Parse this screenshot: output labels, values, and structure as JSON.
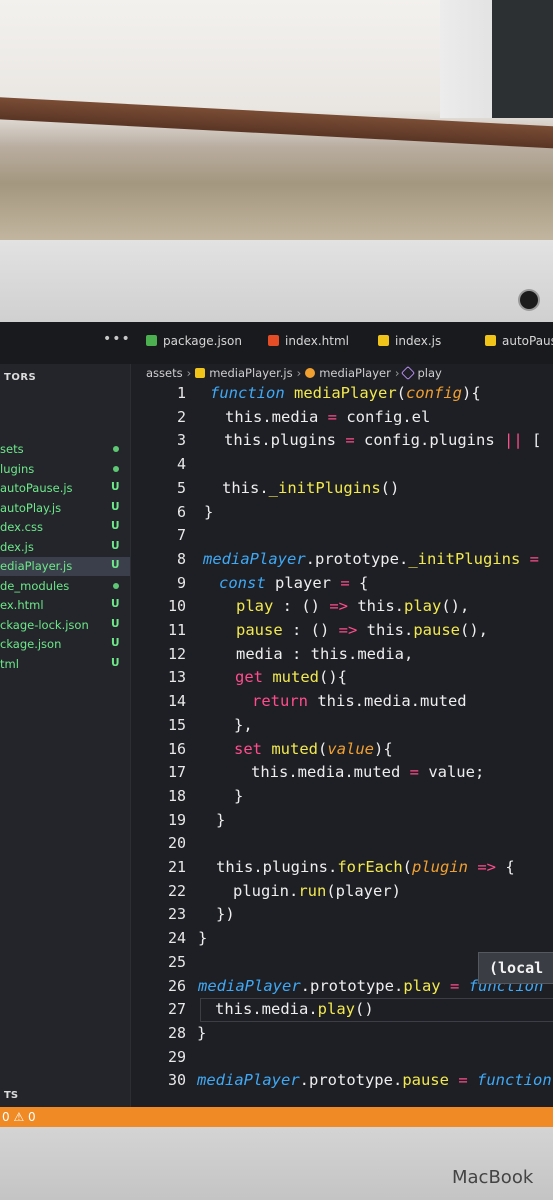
{
  "tabs": [
    {
      "label": "package.json",
      "color": "#4caf50"
    },
    {
      "label": "index.html",
      "color": "#e44d26"
    },
    {
      "label": "index.js",
      "color": "#f0c419"
    },
    {
      "label": "autoPaus",
      "color": "#f0c419"
    }
  ],
  "tab_overflow": "•••",
  "sidebar": {
    "title": "TORS",
    "items": [
      {
        "label": "sets",
        "status": "dot"
      },
      {
        "label": "lugins",
        "status": "dot"
      },
      {
        "label": "autoPause.js",
        "status": "U"
      },
      {
        "label": "autoPlay.js",
        "status": "U"
      },
      {
        "label": "dex.css",
        "status": "U"
      },
      {
        "label": "dex.js",
        "status": "U"
      },
      {
        "label": "ediaPlayer.js",
        "status": "U",
        "active": true
      },
      {
        "label": "de_modules",
        "status": "dot"
      },
      {
        "label": "ex.html",
        "status": "U"
      },
      {
        "label": "ckage-lock.json",
        "status": "U"
      },
      {
        "label": "ckage.json",
        "status": "U"
      },
      {
        "label": "tml",
        "status": "U"
      }
    ],
    "bottom_label": "TS"
  },
  "breadcrumb": [
    "assets",
    "mediaPlayer.js",
    "mediaPlayer",
    "play"
  ],
  "hover_label": "(local",
  "status_text": "0 ⚠ 0",
  "brand": "MacBook",
  "code_lines": [
    {
      "n": "1",
      "indent": 0,
      "html": "<span style='color:#3fa9f5;font-style:italic'>function</span> <span style='color:#f2e94e'>mediaPlayer</span>(<span style='color:#f0a030;font-style:italic'>config</span>){"
    },
    {
      "n": "2",
      "indent": 1,
      "html": "this.media <span style='color:#ff4d8d'>=</span> config.el"
    },
    {
      "n": "3",
      "indent": 1,
      "html": "this.plugins <span style='color:#ff4d8d'>=</span> config.plugins <span style='color:#ff4d8d'>||</span> ["
    },
    {
      "n": "4",
      "indent": 0,
      "html": ""
    },
    {
      "n": "5",
      "indent": 1,
      "html": "this.<span style='color:#f2e94e'>_initPlugins</span>()"
    },
    {
      "n": "6",
      "indent": 0,
      "html": "}"
    },
    {
      "n": "7",
      "indent": 0,
      "html": ""
    },
    {
      "n": "8",
      "indent": 0,
      "html": "<span style='color:#3fa9f5;font-style:italic'>mediaPlayer</span>.prototype.<span style='color:#f2e94e'>_initPlugins</span> <span style='color:#ff4d8d'>=</span>"
    },
    {
      "n": "9",
      "indent": 1,
      "html": "<span style='color:#3fa9f5;font-style:italic'>const</span> player <span style='color:#ff4d8d'>=</span> {"
    },
    {
      "n": "10",
      "indent": 2,
      "html": "<span style='color:#f2e94e'>play</span> : () <span style='color:#ff4d8d'>=&gt;</span> this.<span style='color:#f2e94e'>play</span>(),"
    },
    {
      "n": "11",
      "indent": 2,
      "html": "<span style='color:#f2e94e'>pause</span> : () <span style='color:#ff4d8d'>=&gt;</span> this.<span style='color:#f2e94e'>pause</span>(),"
    },
    {
      "n": "12",
      "indent": 2,
      "html": "media : this.media,"
    },
    {
      "n": "13",
      "indent": 2,
      "html": "<span style='color:#ff4d8d'>get</span> <span style='color:#f2e94e'>muted</span>(){"
    },
    {
      "n": "14",
      "indent": 3,
      "html": "<span style='color:#ff4d8d'>return</span> this.media.muted"
    },
    {
      "n": "15",
      "indent": 2,
      "html": "},"
    },
    {
      "n": "16",
      "indent": 2,
      "html": "<span style='color:#ff4d8d'>set</span> <span style='color:#f2e94e'>muted</span>(<span style='color:#f0a030;font-style:italic'>value</span>){"
    },
    {
      "n": "17",
      "indent": 3,
      "html": "this.media.muted <span style='color:#ff4d8d'>=</span> value;"
    },
    {
      "n": "18",
      "indent": 2,
      "html": "}"
    },
    {
      "n": "19",
      "indent": 1,
      "html": "}"
    },
    {
      "n": "20",
      "indent": 0,
      "html": ""
    },
    {
      "n": "21",
      "indent": 1,
      "html": "this.plugins.<span style='color:#f2e94e'>forEach</span>(<span style='color:#f0a030;font-style:italic'>plugin</span> <span style='color:#ff4d8d'>=&gt;</span> {"
    },
    {
      "n": "22",
      "indent": 2,
      "html": "plugin.<span style='color:#f2e94e'>run</span>(player)"
    },
    {
      "n": "23",
      "indent": 1,
      "html": "})"
    },
    {
      "n": "24",
      "indent": 0,
      "html": "}"
    },
    {
      "n": "25",
      "indent": 0,
      "html": ""
    },
    {
      "n": "26",
      "indent": 0,
      "html": "<span style='color:#3fa9f5;font-style:italic'>mediaPlayer</span>.prototype.<span style='color:#f2e94e'>play</span> <span style='color:#ff4d8d'>=</span> <span style='color:#3fa9f5;font-style:italic'>function</span>"
    },
    {
      "n": "27",
      "indent": 1,
      "html": "this.media.<span style='color:#f2e94e'>play</span>()",
      "highlight": true
    },
    {
      "n": "28",
      "indent": 0,
      "html": "}"
    },
    {
      "n": "29",
      "indent": 0,
      "html": ""
    },
    {
      "n": "30",
      "indent": 0,
      "html": "<span style='color:#3fa9f5;font-style:italic'>mediaPlayer</span>.prototype.<span style='color:#f2e94e'>pause</span> <span style='color:#ff4d8d'>=</span> <span style='color:#3fa9f5;font-style:italic'>function</span>"
    }
  ]
}
